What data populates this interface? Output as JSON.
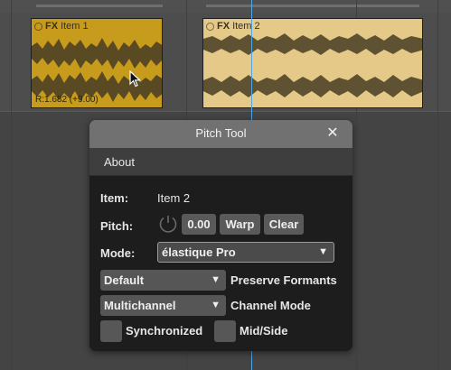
{
  "items": [
    {
      "name": "Item 1",
      "fx_label": "FX",
      "rate_label": "R:1.682 (+9.00)",
      "color": "#c79b1c"
    },
    {
      "name": "Item 2",
      "fx_label": "FX",
      "color": "#e5c988"
    }
  ],
  "dialog": {
    "title": "Pitch Tool",
    "close_icon": "close-icon",
    "menu": {
      "about": "About"
    },
    "item_label": "Item:",
    "item_value": "Item 2",
    "pitch_label": "Pitch:",
    "pitch_value": "0.00",
    "warp_button": "Warp",
    "clear_button": "Clear",
    "mode_label": "Mode:",
    "mode_value": "élastique Pro",
    "formant_select": "Default",
    "formant_label": "Preserve Formants",
    "channel_select": "Multichannel",
    "channel_label": "Channel Mode",
    "synchronized_label": "Synchronized",
    "midside_label": "Mid/Side"
  },
  "colors": {
    "playhead": "#4ea6e6",
    "dialog_title_bg": "#717171"
  }
}
